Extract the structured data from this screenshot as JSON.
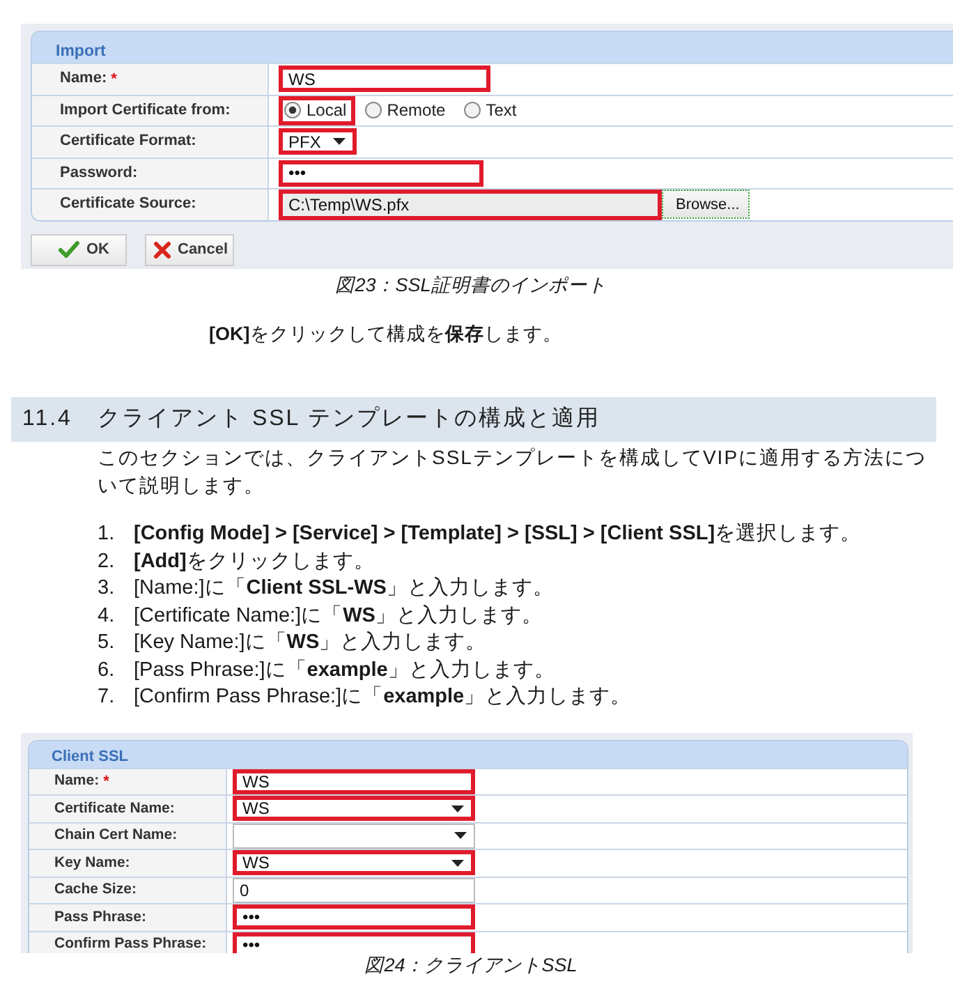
{
  "import_form": {
    "title": "Import",
    "rows": [
      {
        "label": "Name:",
        "required_mark": "*",
        "kind": "text",
        "value": "WS",
        "highlighted": true
      },
      {
        "label": "Import Certificate from:",
        "kind": "radio",
        "options": [
          {
            "label": "Local",
            "selected": true,
            "highlighted": true
          },
          {
            "label": "Remote",
            "selected": false,
            "highlighted": false
          },
          {
            "label": "Text",
            "selected": false,
            "highlighted": false
          }
        ]
      },
      {
        "label": "Certificate Format:",
        "kind": "dropdown",
        "value": "PFX",
        "highlighted": true
      },
      {
        "label": "Password:",
        "kind": "password",
        "value": "•••",
        "highlighted": true
      },
      {
        "label": "Certificate Source:",
        "kind": "file",
        "value": "C:\\Temp\\WS.pfx",
        "highlighted": true,
        "button": {
          "label": "Browse...",
          "focused": true
        }
      }
    ],
    "buttons": [
      {
        "label": "OK",
        "kind": "ok"
      },
      {
        "label": "Cancel",
        "kind": "cancel"
      }
    ]
  },
  "import_caption": "図23：SSL証明書のインポート",
  "instruction": "**[OK]**をクリックして構成を**保存**します。",
  "section": {
    "number": "11.4",
    "title": "クライアント SSL テンプレートの構成と適用"
  },
  "intro": "このセクションでは、クライアントSSLテンプレートを構成してVIPに適用する方法について説明します。",
  "steps": [
    {
      "number": "1.",
      "text": "**[Config Mode] > [Service] > [Template] > [SSL] > [Client SSL]**を選択します。"
    },
    {
      "number": "2.",
      "text": "**[Add]**をクリックします。"
    },
    {
      "number": "3.",
      "text": "[Name:]に「**Client SSL-WS**」と入力します。"
    },
    {
      "number": "4.",
      "text": "[Certificate Name:]に「**WS**」と入力します。"
    },
    {
      "number": "5.",
      "text": "[Key Name:]に「**WS**」と入力します。"
    },
    {
      "number": "6.",
      "text": "[Pass Phrase:]に「**example**」と入力します。"
    },
    {
      "number": "7.",
      "text": "[Confirm Pass Phrase:]に「**example**」と入力します。"
    }
  ],
  "client_ssl_form": {
    "title": "Client SSL",
    "rows": [
      {
        "label": "Name:",
        "required_mark": "*",
        "kind": "text",
        "value": "WS",
        "highlighted": true
      },
      {
        "label": "Certificate Name:",
        "kind": "dropdown",
        "value": "WS",
        "highlighted": true
      },
      {
        "label": "Chain Cert Name:",
        "kind": "dropdown",
        "highlighted": false
      },
      {
        "label": "Key Name:",
        "kind": "dropdown",
        "value": "WS",
        "highlighted": true
      },
      {
        "label": "Cache Size:",
        "kind": "text",
        "value": "0",
        "highlighted": false
      },
      {
        "label": "Pass Phrase:",
        "kind": "password",
        "value": "•••",
        "highlighted": true
      },
      {
        "label": "Confirm Pass Phrase:",
        "kind": "password",
        "value": "•••",
        "highlighted": true
      }
    ]
  },
  "client_ssl_caption": "図24：クライアントSSL"
}
